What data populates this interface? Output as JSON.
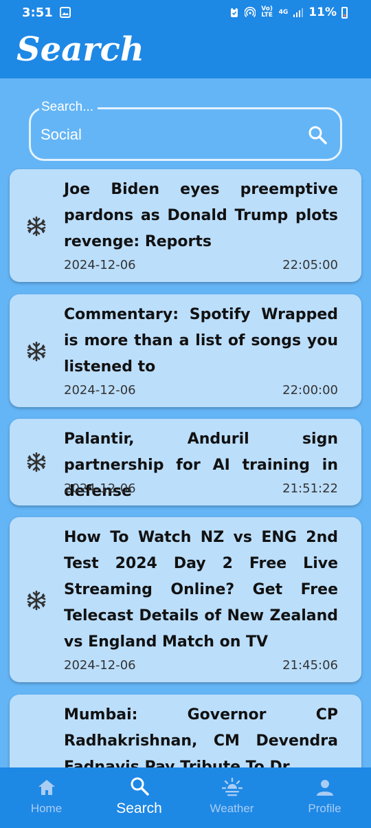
{
  "status_bar": {
    "time": "3:51",
    "battery": "11%",
    "volte": "Vo) LTE",
    "network": "4G"
  },
  "app_bar": {
    "title": "Search"
  },
  "search": {
    "label": "Search...",
    "value": "Social"
  },
  "articles": [
    {
      "title": "Joe Biden eyes preemptive pardons as Donald Trump plots revenge: Reports",
      "date": "2024-12-06",
      "time": "22:05:00"
    },
    {
      "title": "Commentary: Spotify Wrapped is more than a list of songs you listened to",
      "date": "2024-12-06",
      "time": "22:00:00"
    },
    {
      "title": "Palantir, Anduril sign partnership for AI training in defense",
      "date": "2024-12-06",
      "time": "21:51:22"
    },
    {
      "title": "How To Watch NZ vs ENG 2nd Test 2024 Day 2 Free Live Streaming Online? Get Free Telecast Details of New Zealand vs England Match on TV",
      "date": "2024-12-06",
      "time": "21:45:06"
    },
    {
      "title": "Mumbai: Governor CP Radhakrishnan, CM Devendra Fadnavis Pay Tribute To Dr",
      "date": "",
      "time": ""
    }
  ],
  "nav": {
    "home": "Home",
    "search": "Search",
    "weather": "Weather",
    "profile": "Profile"
  },
  "colors": {
    "primary": "#1e88e5",
    "background": "#64b5f6",
    "card": "#bbdefb"
  },
  "icons": [
    "image-icon",
    "snowflake-icon",
    "search-icon",
    "home-icon",
    "weather-icon",
    "profile-icon"
  ]
}
